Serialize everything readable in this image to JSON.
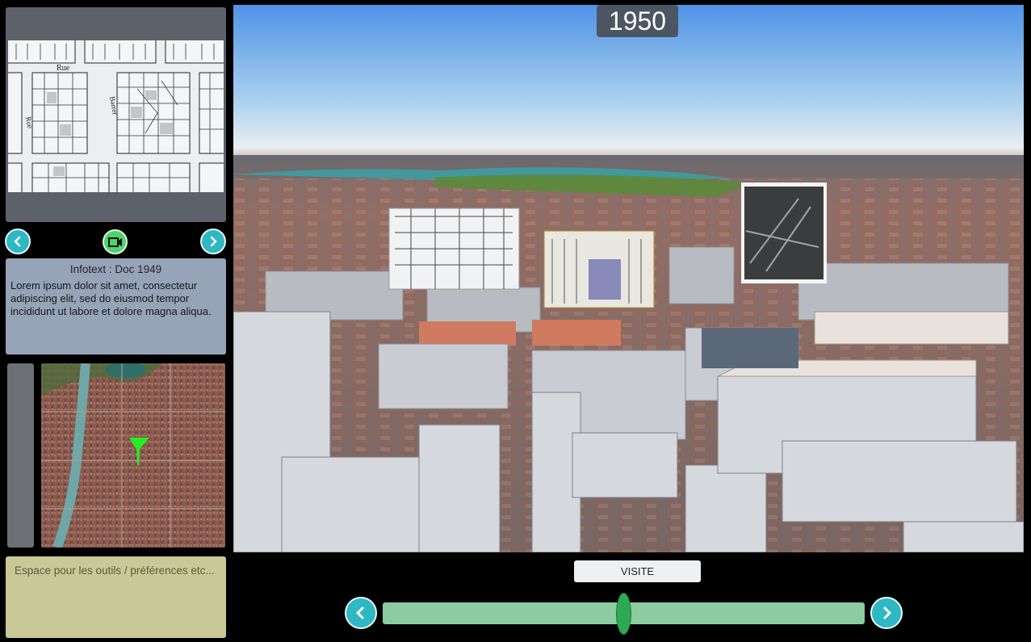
{
  "document_viewer": {
    "street_label_1": "Rue",
    "street_label_2": "Rue",
    "street_label_3": "Barrer"
  },
  "info_panel": {
    "title": "Infotext : Doc 1949",
    "body": "Lorem ipsum dolor sit amet, consectetur adipiscing elit, sed do eiusmod tempor incididunt ut labore et dolore magna aliqua."
  },
  "doc_nav": {
    "prev_icon": "chevron-left-icon",
    "camera_icon": "camera-icon",
    "next_icon": "chevron-right-icon"
  },
  "tools_panel": {
    "text": "Espace pour les outils / préférences etc..."
  },
  "viewport": {
    "year": "1950"
  },
  "timeline": {
    "visite_label": "VISITE",
    "prev_icon": "chevron-left-icon",
    "next_icon": "chevron-right-icon",
    "position_fraction": 0.5
  },
  "colors": {
    "accent_teal": "#2db8c4",
    "camera_green": "#4cd46a",
    "info_bg": "#97a4b7",
    "tools_bg": "#c9c897",
    "timeline_track": "#8ccca0",
    "timeline_handle": "#2fa853",
    "minimap_marker": "#22ee22"
  }
}
